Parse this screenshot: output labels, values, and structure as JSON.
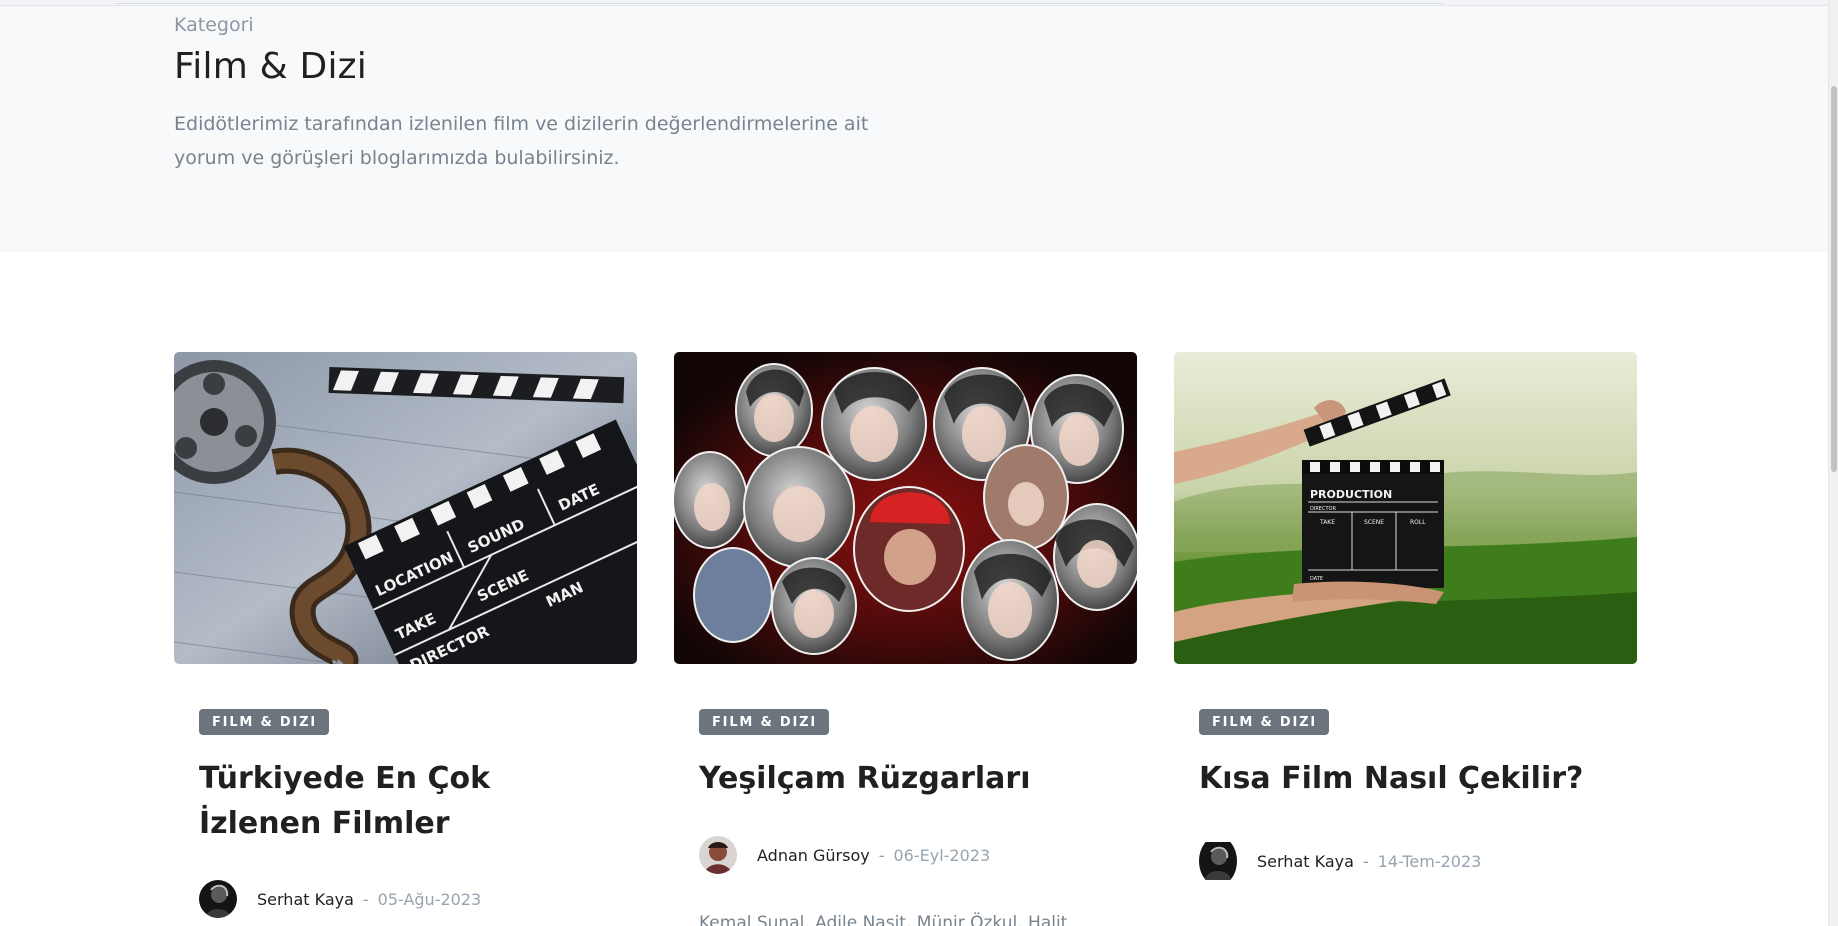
{
  "hero": {
    "eyebrow": "Kategori",
    "title": "Film & Dizi",
    "description": "Edidötlerimiz tarafından izlenilen film ve dizilerin değerlendirmelerine ait yorum ve görüşleri bloglarımızda bulabilirsiniz."
  },
  "posts": [
    {
      "category": "FILM & DIZI",
      "title": "Türkiyede En Çok İzlenen Filmler",
      "author": "Serhat Kaya",
      "separator": "-",
      "date": "05-Ağu-2023",
      "image_text": {
        "location": "LOCATION",
        "sound": "SOUND",
        "date": "DATE",
        "take": "TAKE",
        "scene": "SCENE",
        "director": "DIRECTOR",
        "cameraman": "MAN"
      }
    },
    {
      "category": "FILM & DIZI",
      "title": "Yeşilçam Rüzgarları",
      "author": "Adnan Gürsoy",
      "separator": "-",
      "date": "06-Eyl-2023",
      "excerpt": "Kemal Sunal, Adile Naşit, Münir Özkul, Halit"
    },
    {
      "category": "FILM & DIZI",
      "title": "Kısa Film Nasıl Çekilir?",
      "author": "Serhat Kaya",
      "separator": "-",
      "date": "14-Tem-2023",
      "image_text": {
        "production": "PRODUCTION",
        "director": "DIRECTOR",
        "take": "TAKE",
        "scene": "SCENE",
        "roll": "ROLL",
        "date": "DATE"
      }
    }
  ],
  "icons": {
    "avatar_1": "author-avatar-icon",
    "avatar_2": "author-avatar-icon",
    "avatar_3": "author-avatar-icon"
  },
  "colors": {
    "badge_bg": "#6c757d",
    "hero_bg": "#f8f9fa",
    "muted_text": "#77838f",
    "heading_text": "#1e2022"
  }
}
